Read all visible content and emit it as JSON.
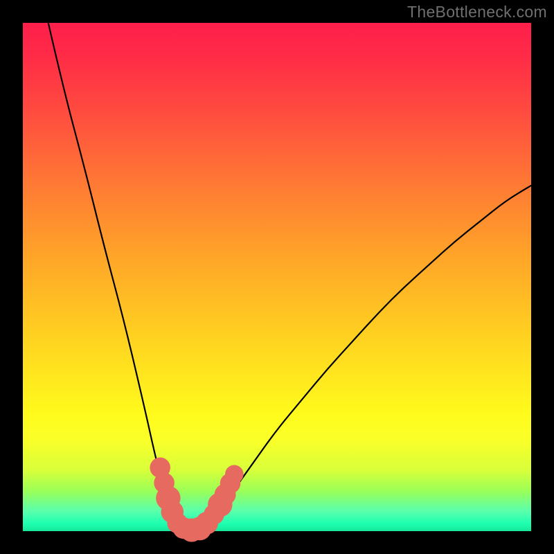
{
  "watermark": "TheBottleneck.com",
  "chart_data": {
    "type": "line",
    "title": "",
    "xlabel": "",
    "ylabel": "",
    "xlim": [
      0,
      100
    ],
    "ylim": [
      0,
      100
    ],
    "series": [
      {
        "name": "bottleneck-curve",
        "x": [
          5,
          8,
          12,
          16,
          20,
          24,
          26,
          28,
          29.5,
          31,
          33,
          35,
          37,
          40,
          45,
          50,
          55,
          60,
          65,
          70,
          75,
          80,
          85,
          90,
          95,
          100
        ],
        "y": [
          100,
          87,
          72,
          56,
          41,
          24,
          15,
          7,
          3,
          0.5,
          0,
          0.5,
          2.5,
          6,
          13,
          20,
          26,
          32,
          37.5,
          43,
          48,
          52.5,
          57,
          61,
          65,
          68
        ]
      }
    ],
    "markers": {
      "name": "highlight-points",
      "color": "#e76a61",
      "points": [
        {
          "x": 27.0,
          "y": 12.5,
          "r": 1.2
        },
        {
          "x": 27.8,
          "y": 9.5,
          "r": 1.2
        },
        {
          "x": 28.6,
          "y": 6.5,
          "r": 1.6
        },
        {
          "x": 29.4,
          "y": 3.8,
          "r": 1.4
        },
        {
          "x": 30.4,
          "y": 1.6,
          "r": 1.2
        },
        {
          "x": 31.6,
          "y": 0.6,
          "r": 1.3
        },
        {
          "x": 33.2,
          "y": 0.2,
          "r": 1.5
        },
        {
          "x": 34.8,
          "y": 0.5,
          "r": 1.5
        },
        {
          "x": 36.2,
          "y": 1.6,
          "r": 1.4
        },
        {
          "x": 37.6,
          "y": 3.3,
          "r": 1.2
        },
        {
          "x": 38.8,
          "y": 5.2,
          "r": 1.6
        },
        {
          "x": 39.8,
          "y": 7.2,
          "r": 1.3
        },
        {
          "x": 40.8,
          "y": 9.4,
          "r": 1.2
        },
        {
          "x": 41.6,
          "y": 11.2,
          "r": 1.0
        }
      ]
    },
    "gradient_stops": [
      {
        "pos": 0,
        "color": "#ff1f4b"
      },
      {
        "pos": 0.45,
        "color": "#ffa229"
      },
      {
        "pos": 0.77,
        "color": "#fffb1c"
      },
      {
        "pos": 1.0,
        "color": "#17e89a"
      }
    ]
  }
}
